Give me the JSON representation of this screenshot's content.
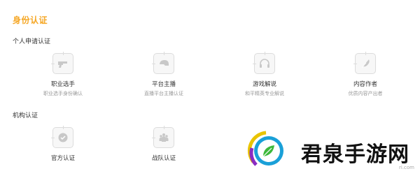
{
  "page": {
    "title": "身份认证"
  },
  "sections": {
    "personal": {
      "title": "个人申请认证",
      "cards": [
        {
          "label": "职业选手",
          "desc": "职业选手身份确认",
          "icon": "gun-icon"
        },
        {
          "label": "平台主播",
          "desc": "直播平台主播认证",
          "icon": "helmet-icon"
        },
        {
          "label": "游戏解说",
          "desc": "和平精英专业解说",
          "icon": "headset-icon"
        },
        {
          "label": "内容作者",
          "desc": "优质内容产出者",
          "icon": "feather-icon"
        }
      ]
    },
    "org": {
      "title": "机构认证",
      "cards": [
        {
          "label": "官方认证",
          "icon": "badge-check-icon"
        },
        {
          "label": "战队认证",
          "icon": "team-icon"
        }
      ]
    }
  },
  "watermark": {
    "brand": "君泉手游网",
    "site": "ri.com"
  },
  "colors": {
    "title_accent": "#f5a623",
    "icon_gray": "#c8c8c8",
    "desc_gray": "#999999"
  }
}
